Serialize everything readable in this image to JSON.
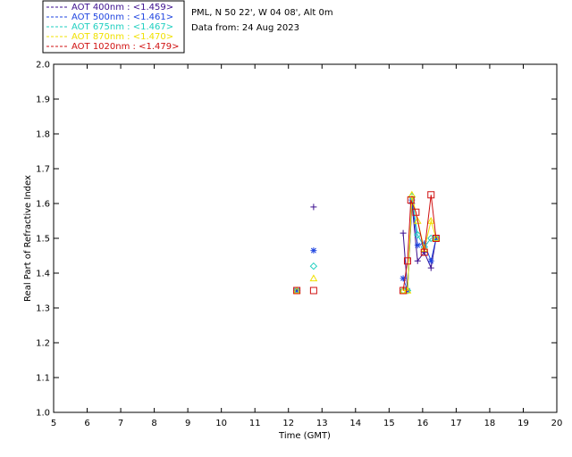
{
  "header": {
    "location": "PML, N 50 22', W 04 08', Alt 0m",
    "data_from": "Data from: 24 Aug 2023"
  },
  "chart_data": {
    "type": "scatter",
    "title": "",
    "xlabel": "Time (GMT)",
    "ylabel": "Real Part of Refractive Index",
    "xlim": [
      5,
      20
    ],
    "ylim": [
      1.0,
      2.0
    ],
    "xticks": [
      5,
      6,
      7,
      8,
      9,
      10,
      11,
      12,
      13,
      14,
      15,
      16,
      17,
      18,
      19,
      20
    ],
    "yticks": [
      "1.0",
      "1.1",
      "1.2",
      "1.3",
      "1.4",
      "1.5",
      "1.6",
      "1.7",
      "1.8",
      "1.9",
      "2.0"
    ],
    "grid": false,
    "legend_position": "top-left",
    "series": [
      {
        "name": "AOT  400nm : <1.459>",
        "color": "#3b0f8f",
        "marker": "plus",
        "isolated": [
          [
            12.25,
            1.35
          ],
          [
            12.75,
            1.59
          ]
        ],
        "line": [
          [
            15.42,
            1.515
          ],
          [
            15.55,
            1.35
          ],
          [
            15.68,
            1.6
          ],
          [
            15.85,
            1.435
          ],
          [
            16.05,
            1.46
          ],
          [
            16.25,
            1.415
          ],
          [
            16.4,
            1.5
          ]
        ]
      },
      {
        "name": "AOT  500nm : <1.461>",
        "color": "#1f45e0",
        "marker": "asterisk",
        "isolated": [
          [
            12.25,
            1.35
          ],
          [
            12.75,
            1.465
          ]
        ],
        "line": [
          [
            15.42,
            1.385
          ],
          [
            15.55,
            1.35
          ],
          [
            15.68,
            1.61
          ],
          [
            15.85,
            1.48
          ],
          [
            16.05,
            1.485
          ],
          [
            16.25,
            1.435
          ],
          [
            16.4,
            1.5
          ]
        ]
      },
      {
        "name": "AOT  675nm : <1.467>",
        "color": "#1ecfc0",
        "marker": "diamond",
        "isolated": [
          [
            12.25,
            1.35
          ],
          [
            12.75,
            1.42
          ]
        ],
        "line": [
          [
            15.42,
            1.35
          ],
          [
            15.55,
            1.35
          ],
          [
            15.68,
            1.62
          ],
          [
            15.85,
            1.51
          ],
          [
            16.05,
            1.475
          ],
          [
            16.25,
            1.5
          ],
          [
            16.4,
            1.5
          ]
        ]
      },
      {
        "name": "AOT  870nm : <1.470>",
        "color": "#f0e000",
        "marker": "triangle",
        "isolated": [
          [
            12.25,
            1.35
          ],
          [
            12.75,
            1.385
          ]
        ],
        "line": [
          [
            15.42,
            1.35
          ],
          [
            15.55,
            1.35
          ],
          [
            15.68,
            1.625
          ],
          [
            15.85,
            1.55
          ],
          [
            16.05,
            1.47
          ],
          [
            16.25,
            1.55
          ],
          [
            16.4,
            1.5
          ]
        ]
      },
      {
        "name": "AOT 1020nm : <1.479>",
        "color": "#d01010",
        "marker": "square",
        "isolated": [
          [
            12.25,
            1.35
          ],
          [
            12.75,
            1.35
          ]
        ],
        "line": [
          [
            15.42,
            1.35
          ],
          [
            15.55,
            1.435
          ],
          [
            15.65,
            1.61
          ],
          [
            15.8,
            1.575
          ],
          [
            16.05,
            1.46
          ],
          [
            16.25,
            1.625
          ],
          [
            16.4,
            1.5
          ]
        ]
      }
    ]
  }
}
